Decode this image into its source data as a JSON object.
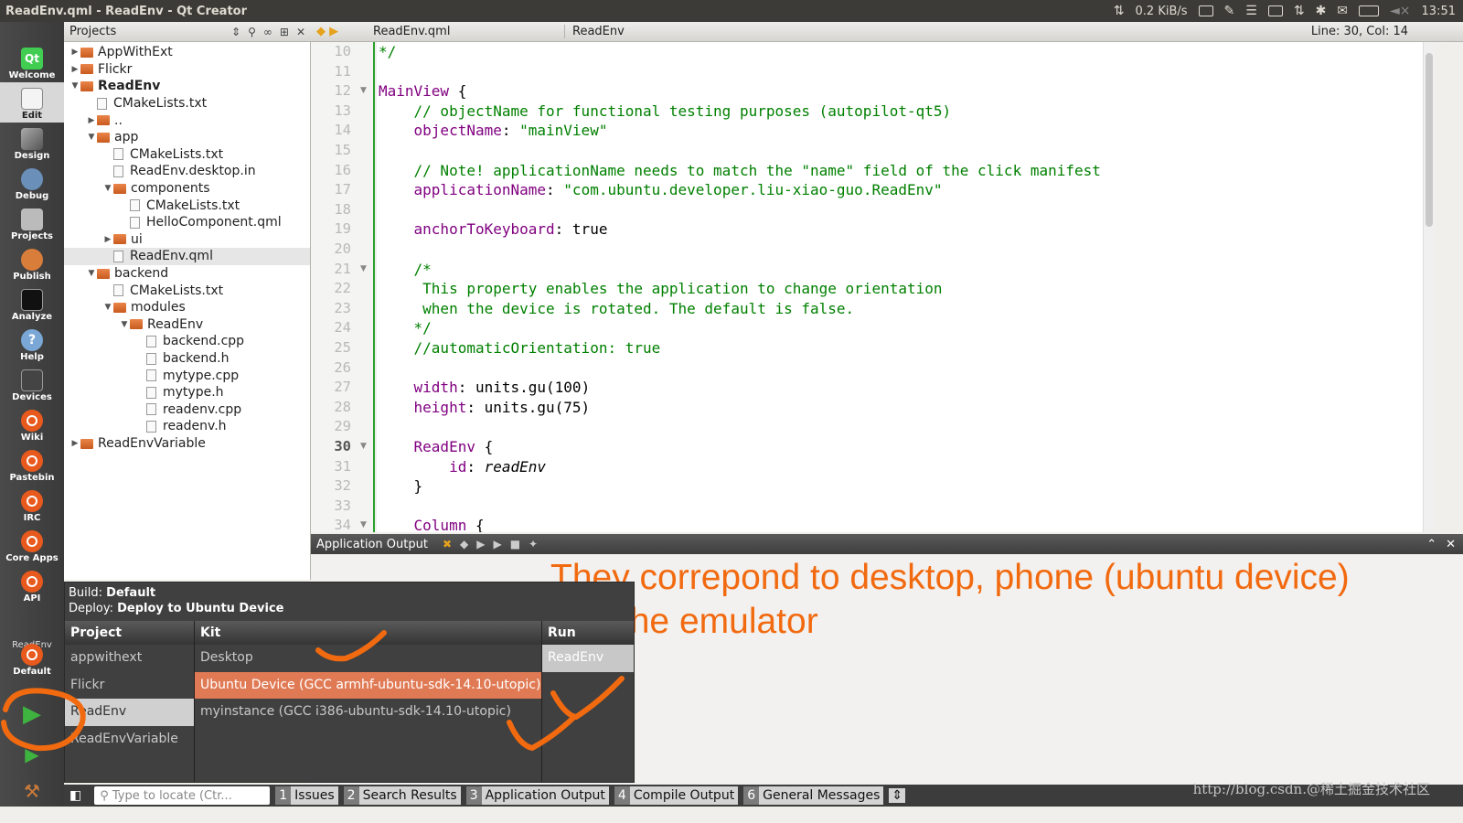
{
  "window": {
    "title": "ReadEnv.qml - ReadEnv - Qt Creator",
    "net_speed": "0.2 KiB/s",
    "clock": "13:51"
  },
  "modes": [
    {
      "label": "Welcome",
      "icon": "qt-logo-icon"
    },
    {
      "label": "Edit",
      "icon": "edit-document-icon"
    },
    {
      "label": "Design",
      "icon": "design-tools-icon"
    },
    {
      "label": "Debug",
      "icon": "debug-bug-icon"
    },
    {
      "label": "Projects",
      "icon": "projects-icon"
    },
    {
      "label": "Publish",
      "icon": "publish-icon"
    },
    {
      "label": "Analyze",
      "icon": "analyze-icon"
    },
    {
      "label": "Help",
      "icon": "help-icon"
    },
    {
      "label": "Devices",
      "icon": "devices-icon"
    },
    {
      "label": "Wiki",
      "icon": "ubuntu-icon"
    },
    {
      "label": "Pastebin",
      "icon": "ubuntu-icon"
    },
    {
      "label": "IRC",
      "icon": "ubuntu-icon"
    },
    {
      "label": "Core Apps",
      "icon": "ubuntu-icon"
    },
    {
      "label": "API",
      "icon": "ubuntu-icon"
    }
  ],
  "kit_selector": {
    "project": "ReadEnv",
    "label": "Default"
  },
  "projects_pane": {
    "title": "Projects",
    "tree": [
      {
        "label": "AppWithExt",
        "depth": 0,
        "type": "folder",
        "arrow": "▶"
      },
      {
        "label": "Flickr",
        "depth": 0,
        "type": "folder",
        "arrow": "▶"
      },
      {
        "label": "ReadEnv",
        "depth": 0,
        "type": "folder",
        "arrow": "▼",
        "bold": true
      },
      {
        "label": "CMakeLists.txt",
        "depth": 1,
        "type": "file"
      },
      {
        "label": "..",
        "depth": 1,
        "type": "folder",
        "arrow": "▶"
      },
      {
        "label": "app",
        "depth": 1,
        "type": "folder",
        "arrow": "▼"
      },
      {
        "label": "CMakeLists.txt",
        "depth": 2,
        "type": "file"
      },
      {
        "label": "ReadEnv.desktop.in",
        "depth": 2,
        "type": "file"
      },
      {
        "label": "components",
        "depth": 2,
        "type": "folder",
        "arrow": "▼"
      },
      {
        "label": "CMakeLists.txt",
        "depth": 3,
        "type": "file"
      },
      {
        "label": "HelloComponent.qml",
        "depth": 3,
        "type": "file"
      },
      {
        "label": "ui",
        "depth": 2,
        "type": "folder",
        "arrow": "▶"
      },
      {
        "label": "ReadEnv.qml",
        "depth": 2,
        "type": "file",
        "selected": true
      },
      {
        "label": "backend",
        "depth": 1,
        "type": "folder",
        "arrow": "▼"
      },
      {
        "label": "CMakeLists.txt",
        "depth": 2,
        "type": "file"
      },
      {
        "label": "modules",
        "depth": 2,
        "type": "folder",
        "arrow": "▼"
      },
      {
        "label": "ReadEnv",
        "depth": 3,
        "type": "folder",
        "arrow": "▼"
      },
      {
        "label": "backend.cpp",
        "depth": 4,
        "type": "file"
      },
      {
        "label": "backend.h",
        "depth": 4,
        "type": "file"
      },
      {
        "label": "mytype.cpp",
        "depth": 4,
        "type": "file"
      },
      {
        "label": "mytype.h",
        "depth": 4,
        "type": "file"
      },
      {
        "label": "readenv.cpp",
        "depth": 4,
        "type": "file"
      },
      {
        "label": "readenv.h",
        "depth": 4,
        "type": "file"
      },
      {
        "label": "ReadEnvVariable",
        "depth": 0,
        "type": "folder",
        "arrow": "▶"
      }
    ]
  },
  "editor": {
    "file_name": "ReadEnv.qml",
    "symbol": "ReadEnv",
    "line_col": "Line: 30, Col: 14",
    "current_line": 30,
    "lines": [
      {
        "n": 10,
        "segs": [
          {
            "c": "cm",
            "t": "*/"
          }
        ]
      },
      {
        "n": 11,
        "segs": []
      },
      {
        "n": 12,
        "fold": true,
        "segs": [
          {
            "c": "kw",
            "t": "MainView"
          },
          {
            "c": "pl",
            "t": " {"
          }
        ]
      },
      {
        "n": 13,
        "segs": [
          {
            "c": "cm",
            "t": "    // objectName for functional testing purposes (autopilot-qt5)"
          }
        ]
      },
      {
        "n": 14,
        "segs": [
          {
            "c": "kw",
            "t": "    objectName"
          },
          {
            "c": "pl",
            "t": ": "
          },
          {
            "c": "st",
            "t": "\"mainView\""
          }
        ]
      },
      {
        "n": 15,
        "segs": []
      },
      {
        "n": 16,
        "segs": [
          {
            "c": "cm",
            "t": "    // Note! applicationName needs to match the \"name\" field of the click manifest"
          }
        ]
      },
      {
        "n": 17,
        "segs": [
          {
            "c": "kw",
            "t": "    applicationName"
          },
          {
            "c": "pl",
            "t": ": "
          },
          {
            "c": "st",
            "t": "\"com.ubuntu.developer.liu-xiao-guo.ReadEnv\""
          }
        ]
      },
      {
        "n": 18,
        "segs": []
      },
      {
        "n": 19,
        "segs": [
          {
            "c": "kw",
            "t": "    anchorToKeyboard"
          },
          {
            "c": "pl",
            "t": ": true"
          }
        ]
      },
      {
        "n": 20,
        "segs": []
      },
      {
        "n": 21,
        "fold": true,
        "segs": [
          {
            "c": "cm",
            "t": "    /*"
          }
        ]
      },
      {
        "n": 22,
        "segs": [
          {
            "c": "cm",
            "t": "     This property enables the application to change orientation"
          }
        ]
      },
      {
        "n": 23,
        "segs": [
          {
            "c": "cm",
            "t": "     when the device is rotated. The default is false."
          }
        ]
      },
      {
        "n": 24,
        "segs": [
          {
            "c": "cm",
            "t": "    */"
          }
        ]
      },
      {
        "n": 25,
        "segs": [
          {
            "c": "cm",
            "t": "    //automaticOrientation: true"
          }
        ]
      },
      {
        "n": 26,
        "segs": []
      },
      {
        "n": 27,
        "segs": [
          {
            "c": "kw",
            "t": "    width"
          },
          {
            "c": "pl",
            "t": ": units.gu(100)"
          }
        ]
      },
      {
        "n": 28,
        "segs": [
          {
            "c": "kw",
            "t": "    height"
          },
          {
            "c": "pl",
            "t": ": units.gu(75)"
          }
        ]
      },
      {
        "n": 29,
        "segs": []
      },
      {
        "n": 30,
        "fold": true,
        "segs": [
          {
            "c": "kw",
            "t": "    ReadEnv"
          },
          {
            "c": "pl",
            "t": " {"
          }
        ]
      },
      {
        "n": 31,
        "segs": [
          {
            "c": "kw",
            "t": "        id"
          },
          {
            "c": "pl",
            "t": ": "
          },
          {
            "c": "pl it",
            "t": "readEnv"
          }
        ]
      },
      {
        "n": 32,
        "segs": [
          {
            "c": "pl",
            "t": "    }"
          }
        ]
      },
      {
        "n": 33,
        "segs": []
      },
      {
        "n": 34,
        "fold": true,
        "segs": [
          {
            "c": "kw",
            "t": "    Column"
          },
          {
            "c": "pl",
            "t": " {"
          }
        ]
      }
    ]
  },
  "output_pane": {
    "title": "Application Output"
  },
  "annotation": {
    "line1": "They correpond to desktop, phone (ubuntu device)",
    "line2": "and the emulator"
  },
  "kit_popup": {
    "build_label": "Build:",
    "build_value": "Default",
    "deploy_label": "Deploy:",
    "deploy_value": "Deploy to Ubuntu Device",
    "col_project": "Project",
    "col_kit": "Kit",
    "col_run": "Run",
    "projects": [
      "appwithext",
      "Flickr",
      "ReadEnv",
      "ReadEnvVariable"
    ],
    "kits": [
      "Desktop",
      "Ubuntu Device (GCC armhf-ubuntu-sdk-14.10-utopic)",
      "myinstance (GCC i386-ubuntu-sdk-14.10-utopic)"
    ],
    "runs": [
      "ReadEnv"
    ]
  },
  "statusbar": {
    "locator_placeholder": "Type to locate (Ctr...",
    "tabs": [
      {
        "n": "1",
        "label": "Issues"
      },
      {
        "n": "2",
        "label": "Search Results"
      },
      {
        "n": "3",
        "label": "Application Output"
      },
      {
        "n": "4",
        "label": "Compile Output"
      },
      {
        "n": "6",
        "label": "General Messages"
      }
    ]
  },
  "watermark": "http://blog.csdn.@稀土掘金技术社区",
  "colors": {
    "accent_orange": "#f26a10",
    "qt_green": "#41cd52",
    "ubuntu_orange": "#e8591d"
  }
}
